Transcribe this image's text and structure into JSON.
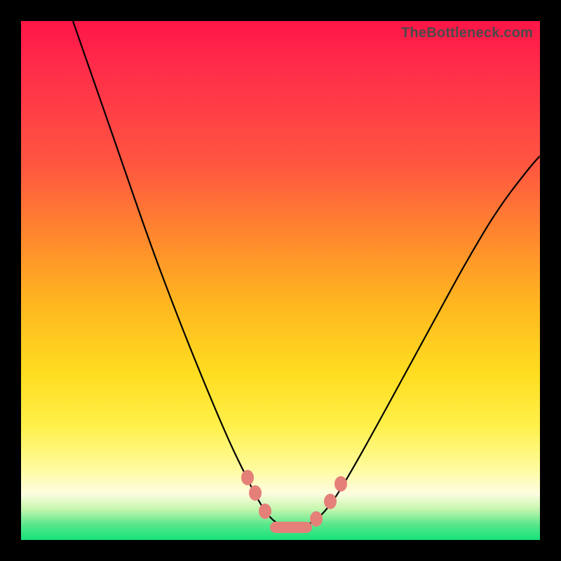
{
  "watermark": "TheBottleneck.com",
  "colors": {
    "bg_border": "#000000",
    "gradient_top": "#ff1547",
    "gradient_mid1": "#ff8a2d",
    "gradient_mid2": "#ffdd20",
    "gradient_pale": "#fdfde0",
    "gradient_green": "#16e27a",
    "curve": "#000000",
    "marker": "#e58079",
    "watermark_text": "#4a4a4a"
  },
  "chart_data": {
    "type": "line",
    "title": "",
    "xlabel": "",
    "ylabel": "",
    "xlim": [
      0,
      100
    ],
    "ylim": [
      0,
      100
    ],
    "grid": false,
    "legend": false,
    "curve_points_normalized_from_topleft": [
      [
        0.1,
        0.0
      ],
      [
        0.15,
        0.143
      ],
      [
        0.2,
        0.288
      ],
      [
        0.25,
        0.432
      ],
      [
        0.3,
        0.565
      ],
      [
        0.35,
        0.69
      ],
      [
        0.4,
        0.808
      ],
      [
        0.43,
        0.87
      ],
      [
        0.455,
        0.92
      ],
      [
        0.475,
        0.952
      ],
      [
        0.495,
        0.97
      ],
      [
        0.515,
        0.977
      ],
      [
        0.535,
        0.977
      ],
      [
        0.555,
        0.97
      ],
      [
        0.58,
        0.952
      ],
      [
        0.605,
        0.92
      ],
      [
        0.635,
        0.87
      ],
      [
        0.68,
        0.79
      ],
      [
        0.74,
        0.68
      ],
      [
        0.8,
        0.57
      ],
      [
        0.86,
        0.46
      ],
      [
        0.92,
        0.36
      ],
      [
        0.98,
        0.282
      ],
      [
        1.0,
        0.26
      ]
    ],
    "markers_normalized_from_topleft": [
      {
        "shape": "dot",
        "x": 0.437,
        "y": 0.88
      },
      {
        "shape": "dot",
        "x": 0.451,
        "y": 0.91
      },
      {
        "shape": "dot",
        "x": 0.47,
        "y": 0.945
      },
      {
        "shape": "pill",
        "x": 0.52,
        "y": 0.975
      },
      {
        "shape": "dot",
        "x": 0.569,
        "y": 0.96
      },
      {
        "shape": "dot",
        "x": 0.596,
        "y": 0.925
      },
      {
        "shape": "dot",
        "x": 0.616,
        "y": 0.892
      }
    ]
  }
}
